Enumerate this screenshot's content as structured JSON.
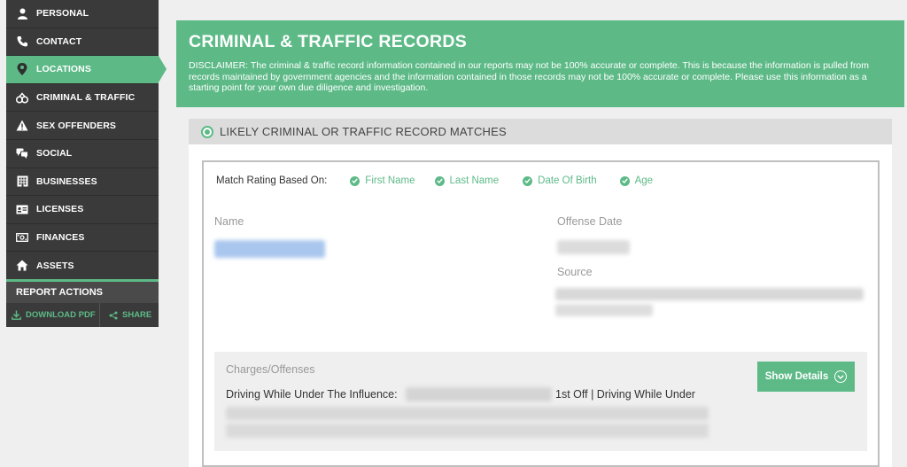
{
  "sidebar": {
    "items": [
      {
        "label": "PERSONAL",
        "icon": "person-icon"
      },
      {
        "label": "CONTACT",
        "icon": "phone-icon"
      },
      {
        "label": "LOCATIONS",
        "icon": "map-pin-icon",
        "active": true
      },
      {
        "label": "CRIMINAL & TRAFFIC",
        "icon": "handcuffs-icon"
      },
      {
        "label": "SEX OFFENDERS",
        "icon": "warning-icon"
      },
      {
        "label": "SOCIAL",
        "icon": "chat-bubbles-icon"
      },
      {
        "label": "BUSINESSES",
        "icon": "building-icon"
      },
      {
        "label": "LICENSES",
        "icon": "id-card-icon"
      },
      {
        "label": "FINANCES",
        "icon": "money-icon"
      },
      {
        "label": "ASSETS",
        "icon": "house-icon"
      }
    ],
    "report_actions": {
      "title": "REPORT ACTIONS",
      "download_label": "DOWNLOAD PDF",
      "share_label": "SHARE"
    }
  },
  "header": {
    "title": "CRIMINAL & TRAFFIC RECORDS",
    "disclaimer": "DISCLAIMER: The criminal & traffic record information contained in our reports may not be 100% accurate or complete. This is because the information is pulled from records maintained by government agencies and the information contained in those records may not be 100% accurate or complete. Please use this information as a starting point for your own due diligence and investigation."
  },
  "matches": {
    "title": "LIKELY CRIMINAL OR TRAFFIC RECORD MATCHES"
  },
  "record": {
    "match_rating_label": "Match Rating Based On:",
    "criteria": [
      "First Name",
      "Last Name",
      "Date Of Birth",
      "Age"
    ],
    "name_label": "Name",
    "offense_date_label": "Offense Date",
    "source_label": "Source",
    "charges_label": "Charges/Offenses",
    "charges_text_start": "Driving While Under The Influence:",
    "charges_text_end": "1st Off | Driving While Under",
    "show_details_label": "Show Details"
  },
  "colors": {
    "accent": "#5dba87",
    "sidebar_bg": "#3a3a3a"
  }
}
